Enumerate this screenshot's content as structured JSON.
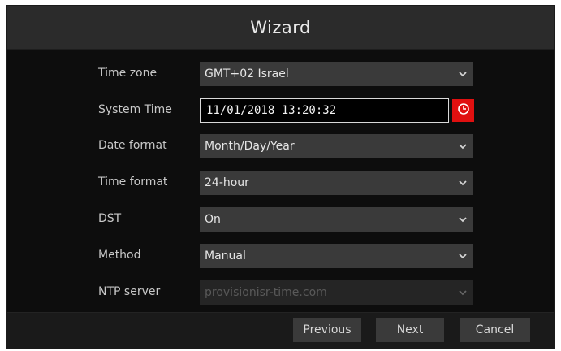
{
  "window": {
    "title": "Wizard"
  },
  "form": {
    "time_zone": {
      "label": "Time zone",
      "value": "GMT+02 Israel"
    },
    "system_time": {
      "label": "System Time",
      "value": "11/01/2018 13:20:32"
    },
    "date_format": {
      "label": "Date format",
      "value": "Month/Day/Year"
    },
    "time_format": {
      "label": "Time format",
      "value": "24-hour"
    },
    "dst": {
      "label": "DST",
      "value": "On"
    },
    "method": {
      "label": "Method",
      "value": "Manual"
    },
    "ntp_server": {
      "label": "NTP server",
      "value": "provisionisr-time.com"
    }
  },
  "footer": {
    "previous_label": "Previous",
    "next_label": "Next",
    "cancel_label": "Cancel"
  },
  "colors": {
    "background": "#0d0d0d",
    "title_bar": "#2b2b2b",
    "field": "#3a3a3a",
    "accent_red": "#e01010"
  },
  "icons": {
    "dropdown": "chevron-down-icon",
    "clock": "clock-icon"
  }
}
